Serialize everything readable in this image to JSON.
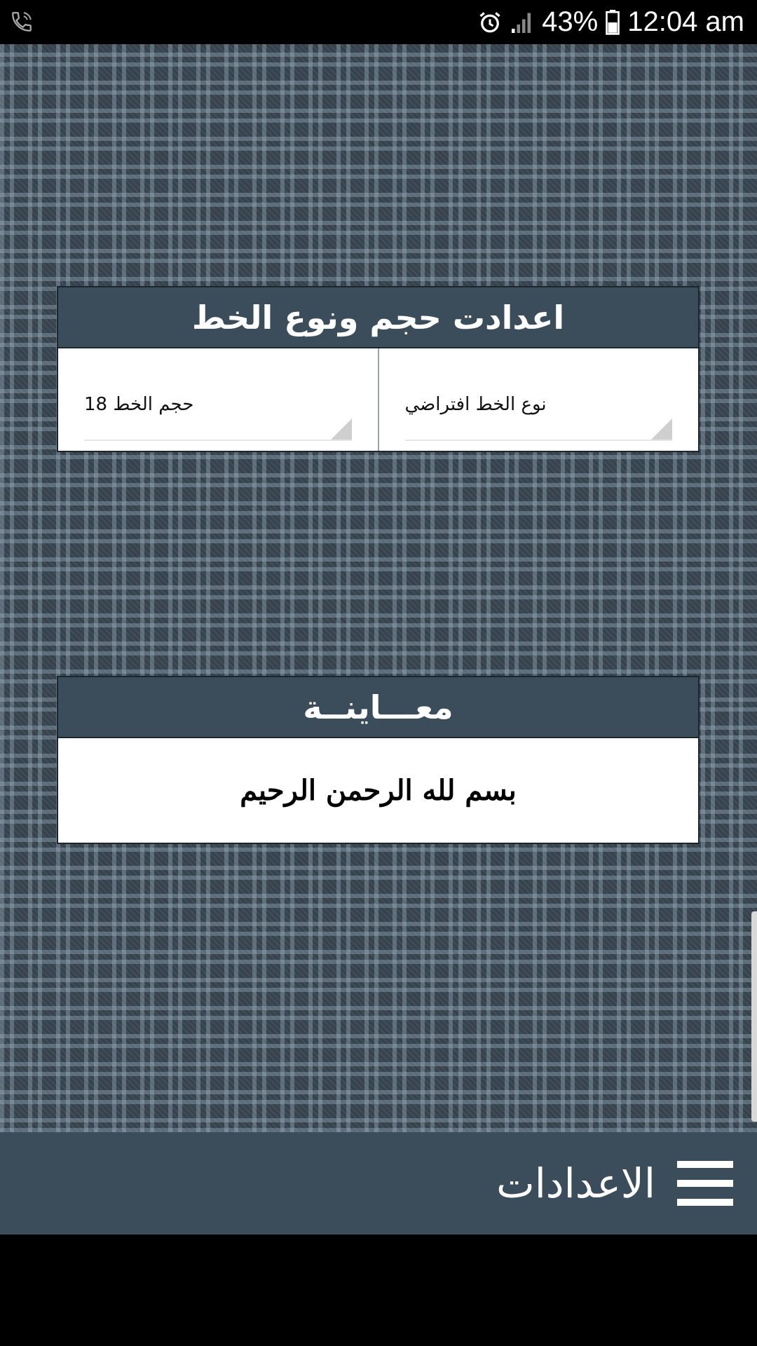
{
  "status_bar": {
    "battery": "43%",
    "time": "12:04 am"
  },
  "font_settings": {
    "title": "اعدادت حجم ونوع الخط",
    "font_type_label": "نوع الخط افتراضي",
    "font_size_label": "حجم الخط 18"
  },
  "preview": {
    "title": "معـــاينــة",
    "text": "بسم لله الرحمن الرحيم"
  },
  "toolbar": {
    "title": "الاعدادات"
  }
}
